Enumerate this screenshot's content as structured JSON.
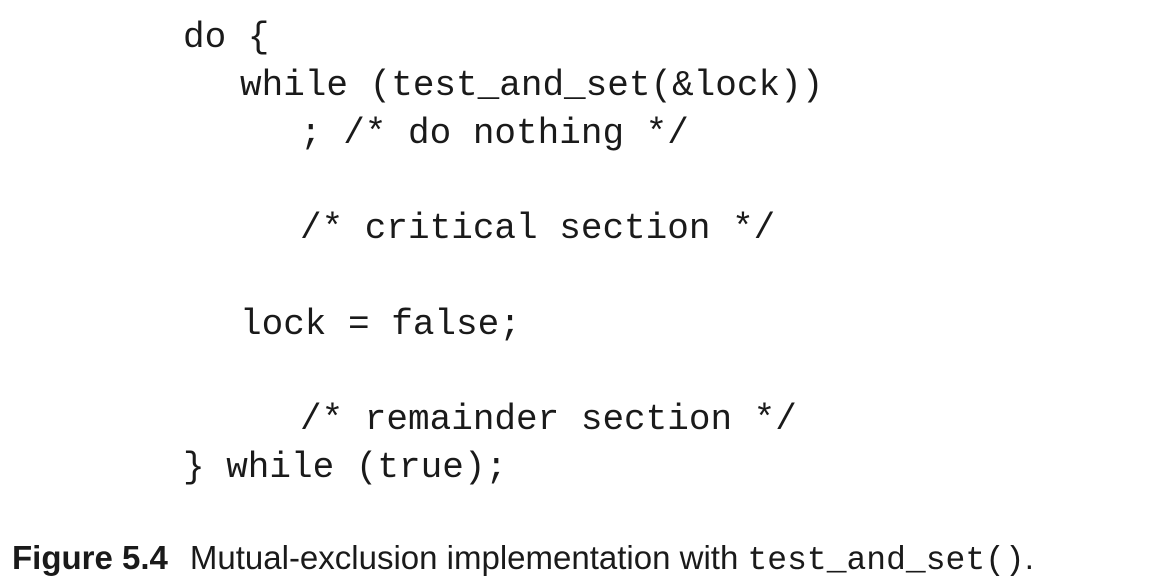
{
  "code": {
    "lines": [
      "do {",
      "while (test_and_set(&lock))",
      "; /* do nothing */",
      "/* critical section */",
      "lock = false;",
      "/* remainder section */",
      "} while (true);"
    ]
  },
  "caption": {
    "label": "Figure 5.4",
    "text": "Mutual-exclusion implementation with ",
    "code": "test_and_set()",
    "end": "."
  }
}
